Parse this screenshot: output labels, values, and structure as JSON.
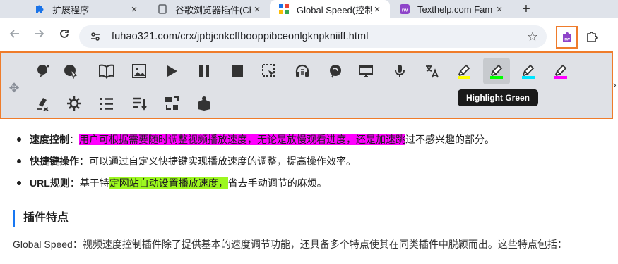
{
  "tabs": [
    {
      "title": "扩展程序",
      "icon": "puzzle-icon"
    },
    {
      "title": "谷歌浏览器插件(Ch",
      "icon": "chrome-file-icon"
    },
    {
      "title": "Global Speed(控制",
      "icon": "site-favicon-icon",
      "active": true
    },
    {
      "title": "Texthelp.com Fam",
      "icon": "texthelp-icon"
    }
  ],
  "address": {
    "url": "fuhao321.com/crx/jpbjcnkcffbooppibceonlgknpkniiff.html"
  },
  "rw_toolbar": {
    "buttons_row1": [
      {
        "name": "hover-speech-icon"
      },
      {
        "name": "click-to-speak-icon"
      },
      {
        "name": "dictionary-icon"
      },
      {
        "name": "picture-dictionary-icon"
      },
      {
        "name": "play-icon"
      },
      {
        "name": "pause-icon"
      },
      {
        "name": "stop-icon"
      },
      {
        "name": "screenshot-reader-icon"
      },
      {
        "name": "audio-maker-icon"
      },
      {
        "name": "voice-note-icon"
      },
      {
        "name": "screen-mask-icon"
      },
      {
        "name": "microphone-icon"
      },
      {
        "name": "translate-icon"
      },
      {
        "name": "highlight-yellow-icon",
        "color": "#ffff00"
      },
      {
        "name": "highlight-green-icon",
        "color": "#00ff00",
        "selected": true
      },
      {
        "name": "highlight-cyan-icon",
        "color": "#00e5ff"
      },
      {
        "name": "highlight-pink-icon",
        "color": "#ff00ff"
      }
    ],
    "buttons_row2": [
      {
        "name": "clear-highlights-icon"
      },
      {
        "name": "collect-highlights-icon"
      },
      {
        "name": "vocabulary-list-icon"
      },
      {
        "name": "summarize-icon"
      },
      {
        "name": "simplify-icon"
      },
      {
        "name": "practice-reading-icon"
      }
    ],
    "tooltip": "Highlight Green"
  },
  "content": {
    "bullets": [
      {
        "label": "速度控制",
        "sep": "：",
        "highlight": "用户可根据需要随时调整视频播放速度，无论是放慢观看进度，还是加速跳",
        "rest": "过不感兴趣的部分。"
      },
      {
        "label": "快捷键操作",
        "sep": "：",
        "text": "可以通过自定义快捷键实现播放速度的调整，提高操作效率。"
      },
      {
        "label": "URL规则",
        "sep": "：",
        "pre": "基于特",
        "highlight": "定网站自动设置播放速度，",
        "rest": "省去手动调节的麻烦。"
      }
    ],
    "section_title": "插件特点",
    "paragraph": "Global  Speed：视频速度控制插件除了提供基本的速度调节功能，还具备多个特点使其在同类插件中脱颖而出。这些特点包括："
  },
  "colors": {
    "accent_orange": "#ef7c2b",
    "toolbar_bg": "#dfe1e6",
    "tab_strip": "#dfe3ea"
  }
}
